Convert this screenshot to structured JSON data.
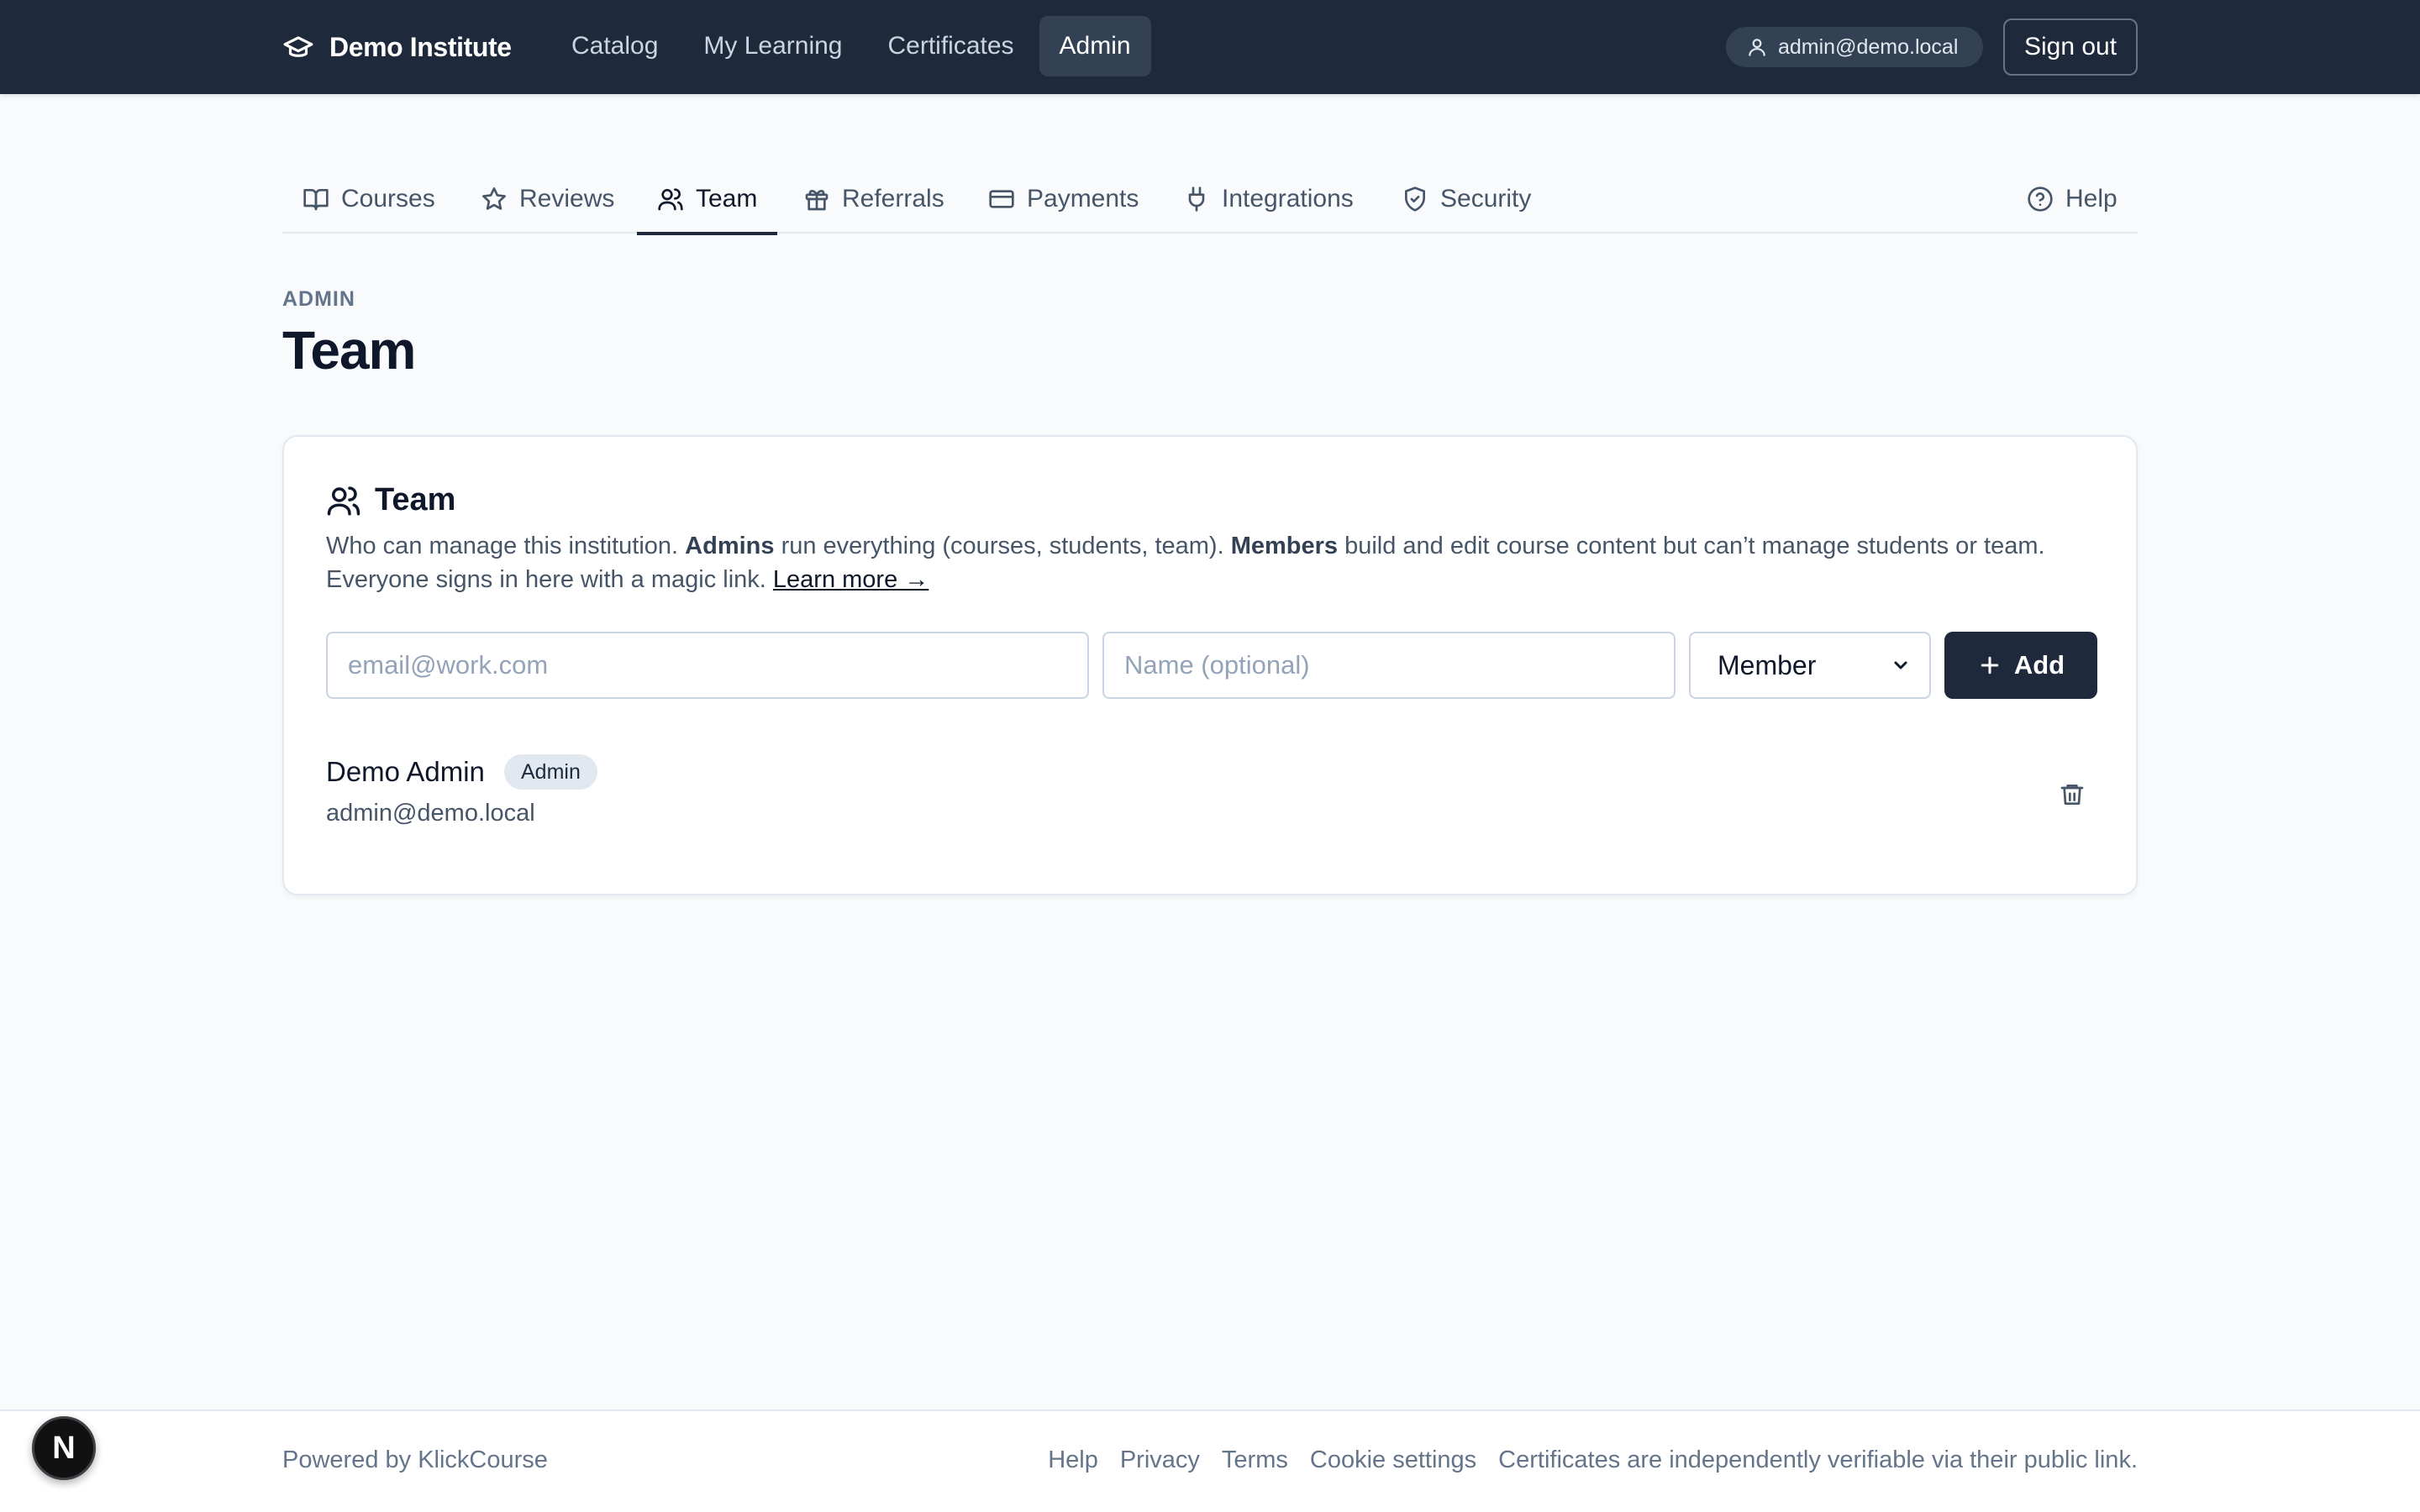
{
  "header": {
    "brand": "Demo Institute",
    "nav": [
      {
        "label": "Catalog"
      },
      {
        "label": "My Learning"
      },
      {
        "label": "Certificates"
      },
      {
        "label": "Admin"
      }
    ],
    "active_nav": "Admin",
    "user_email": "admin@demo.local",
    "sign_out_label": "Sign out"
  },
  "tabs": [
    {
      "label": "Courses",
      "icon": "book-icon"
    },
    {
      "label": "Reviews",
      "icon": "star-icon"
    },
    {
      "label": "Team",
      "icon": "users-icon"
    },
    {
      "label": "Referrals",
      "icon": "gift-icon"
    },
    {
      "label": "Payments",
      "icon": "credit-card-icon"
    },
    {
      "label": "Integrations",
      "icon": "plug-icon"
    },
    {
      "label": "Security",
      "icon": "shield-icon"
    }
  ],
  "active_tab": "Team",
  "help_tab": {
    "label": "Help",
    "icon": "help-circle-icon"
  },
  "page": {
    "eyebrow": "ADMIN",
    "title": "Team"
  },
  "team_card": {
    "title": "Team",
    "desc_part1": "Who can manage this institution. ",
    "desc_admins": "Admins",
    "desc_part2": " run everything (courses, students, team). ",
    "desc_members": "Members",
    "desc_part3": " build and edit course content but can’t manage students or team. Everyone signs in here with a magic link. ",
    "learn_more": "Learn more →",
    "email_placeholder": "email@work.com",
    "name_placeholder": "Name (optional)",
    "role_selected": "Member",
    "add_label": "Add",
    "members": [
      {
        "name": "Demo Admin",
        "role": "Admin",
        "email": "admin@demo.local"
      }
    ]
  },
  "footer": {
    "powered": "Powered by KlickCourse",
    "links": [
      "Help",
      "Privacy",
      "Terms",
      "Cookie settings"
    ],
    "note": "Certificates are independently verifiable via their public link."
  },
  "dev_badge": "N",
  "colors": {
    "nav_bg": "#1e293b",
    "page_bg": "#f8fafc",
    "primary_button": "#1e293b",
    "muted_text": "#64748b"
  }
}
